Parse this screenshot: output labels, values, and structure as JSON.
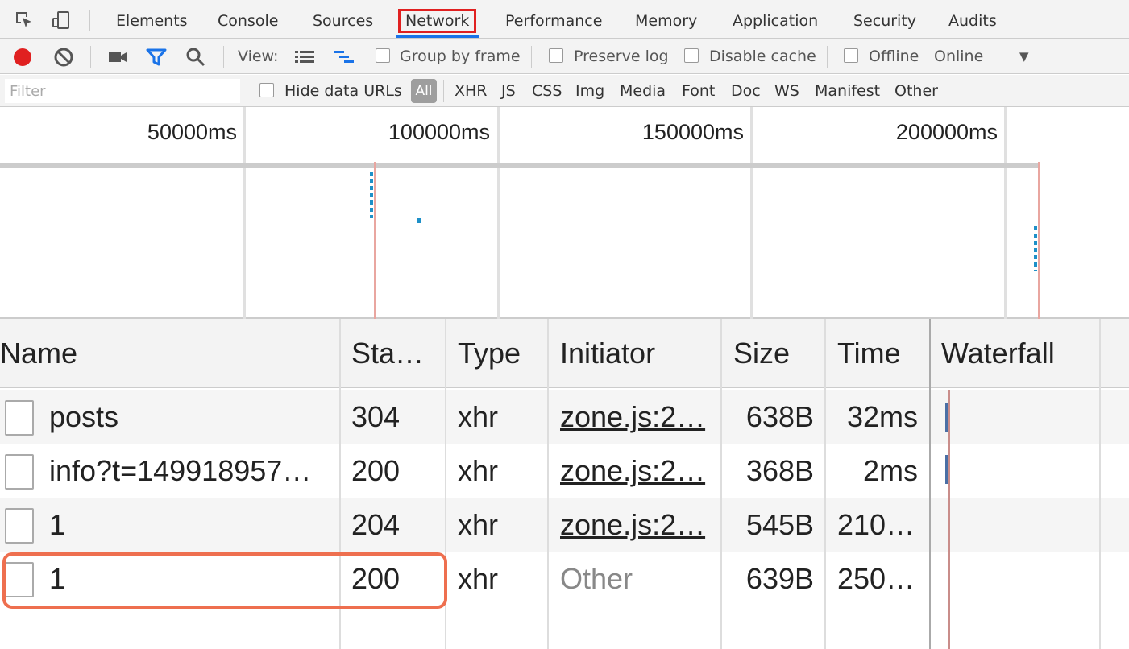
{
  "tabs": [
    {
      "label": "Elements"
    },
    {
      "label": "Console"
    },
    {
      "label": "Sources"
    },
    {
      "label": "Network"
    },
    {
      "label": "Performance"
    },
    {
      "label": "Memory"
    },
    {
      "label": "Application"
    },
    {
      "label": "Security"
    },
    {
      "label": "Audits"
    }
  ],
  "active_tab": "Network",
  "toolbar": {
    "view_label": "View:",
    "group_by_frame": "Group by frame",
    "preserve_log": "Preserve log",
    "disable_cache": "Disable cache",
    "offline": "Offline",
    "throttle_value": "Online"
  },
  "filter": {
    "placeholder": "Filter",
    "hide_data_urls": "Hide data URLs",
    "types": [
      "All",
      "XHR",
      "JS",
      "CSS",
      "Img",
      "Media",
      "Font",
      "Doc",
      "WS",
      "Manifest",
      "Other"
    ]
  },
  "overview": {
    "ticks": [
      "50000ms",
      "100000ms",
      "150000ms",
      "200000ms"
    ]
  },
  "table": {
    "columns": [
      "Name",
      "Sta…",
      "Type",
      "Initiator",
      "Size",
      "Time",
      "Waterfall"
    ],
    "rows": [
      {
        "name": "posts",
        "status": "304",
        "type": "xhr",
        "initiator": "zone.js:2…",
        "size": "638B",
        "time": "32ms"
      },
      {
        "name": "info?t=149918957…",
        "status": "200",
        "type": "xhr",
        "initiator": "zone.js:2…",
        "size": "368B",
        "time": "2ms"
      },
      {
        "name": "1",
        "status": "204",
        "type": "xhr",
        "initiator": "zone.js:2…",
        "size": "545B",
        "time": "210…"
      },
      {
        "name": "1",
        "status": "200",
        "type": "xhr",
        "initiator": "Other",
        "size": "639B",
        "time": "250…"
      }
    ]
  },
  "colors": {
    "record_red": "#e02020",
    "accent_blue": "#1a73e8",
    "highlight_orange": "#ee6f4f"
  },
  "icons": [
    "inspect-element-icon",
    "device-toggle-icon",
    "record-icon",
    "clear-icon",
    "capture-screenshots-icon",
    "filter-icon",
    "search-icon",
    "list-view-icon",
    "waterfall-view-icon",
    "dropdown-arrow-icon",
    "file-icon"
  ]
}
